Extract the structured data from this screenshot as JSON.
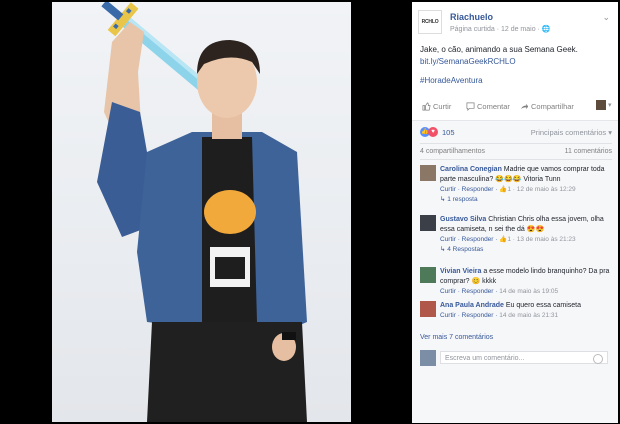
{
  "post": {
    "page_name": "Riachuelo",
    "page_logo_text": "RCHLO",
    "subtitle": "Página curtida · 12 de maio · ",
    "text": "Jake, o cão, animando a sua Semana Geek.",
    "link": "bit.ly/SemanaGeekRCHLO",
    "hashtag": "#HoradeAventura",
    "actions": {
      "like": "Curtir",
      "comment": "Comentar",
      "share": "Compartilhar"
    }
  },
  "reactions": {
    "count": "105",
    "filter": "Principais comentários"
  },
  "stats": {
    "shares": "4 compartilhamentos",
    "comments": "11 comentários"
  },
  "comments": [
    {
      "name": "Carolina Conegian",
      "text": "Madrie que vamos comprar toda parte masculina? 😂😂😂 Vitoria Tunn",
      "actions": "Curtir · Responder · ",
      "likes": "1",
      "time": " · 12 de maio às 12:29",
      "replies": "↳ 1 resposta"
    },
    {
      "name": "Gustavo Silva",
      "text": "Christian Chris olha essa jovem, olha essa camiseta, n sei the dá 😍😍",
      "actions": "Curtir · Responder · ",
      "likes": "1",
      "time": " · 13 de maio às 21:23",
      "replies": "↳ 4 Respostas"
    },
    {
      "name": "Vivian Vieira",
      "text": "a esse modelo lindo branquinho? Da pra comprar? 😊 kkkk",
      "actions": "Curtir · Responder · ",
      "likes": "",
      "time": "14 de maio às 19:05",
      "replies": ""
    },
    {
      "name": "Ana Paula Andrade",
      "text": "Eu quero essa camiseta",
      "actions": "Curtir · Responder · ",
      "likes": "",
      "time": "14 de maio às 21:31",
      "replies": ""
    }
  ],
  "more_comments": "Ver mais 7 comentários",
  "composer_placeholder": "Escreva um comentário...",
  "colors": {
    "link": "#365899",
    "like": "#5890ff",
    "love": "#f25268"
  }
}
